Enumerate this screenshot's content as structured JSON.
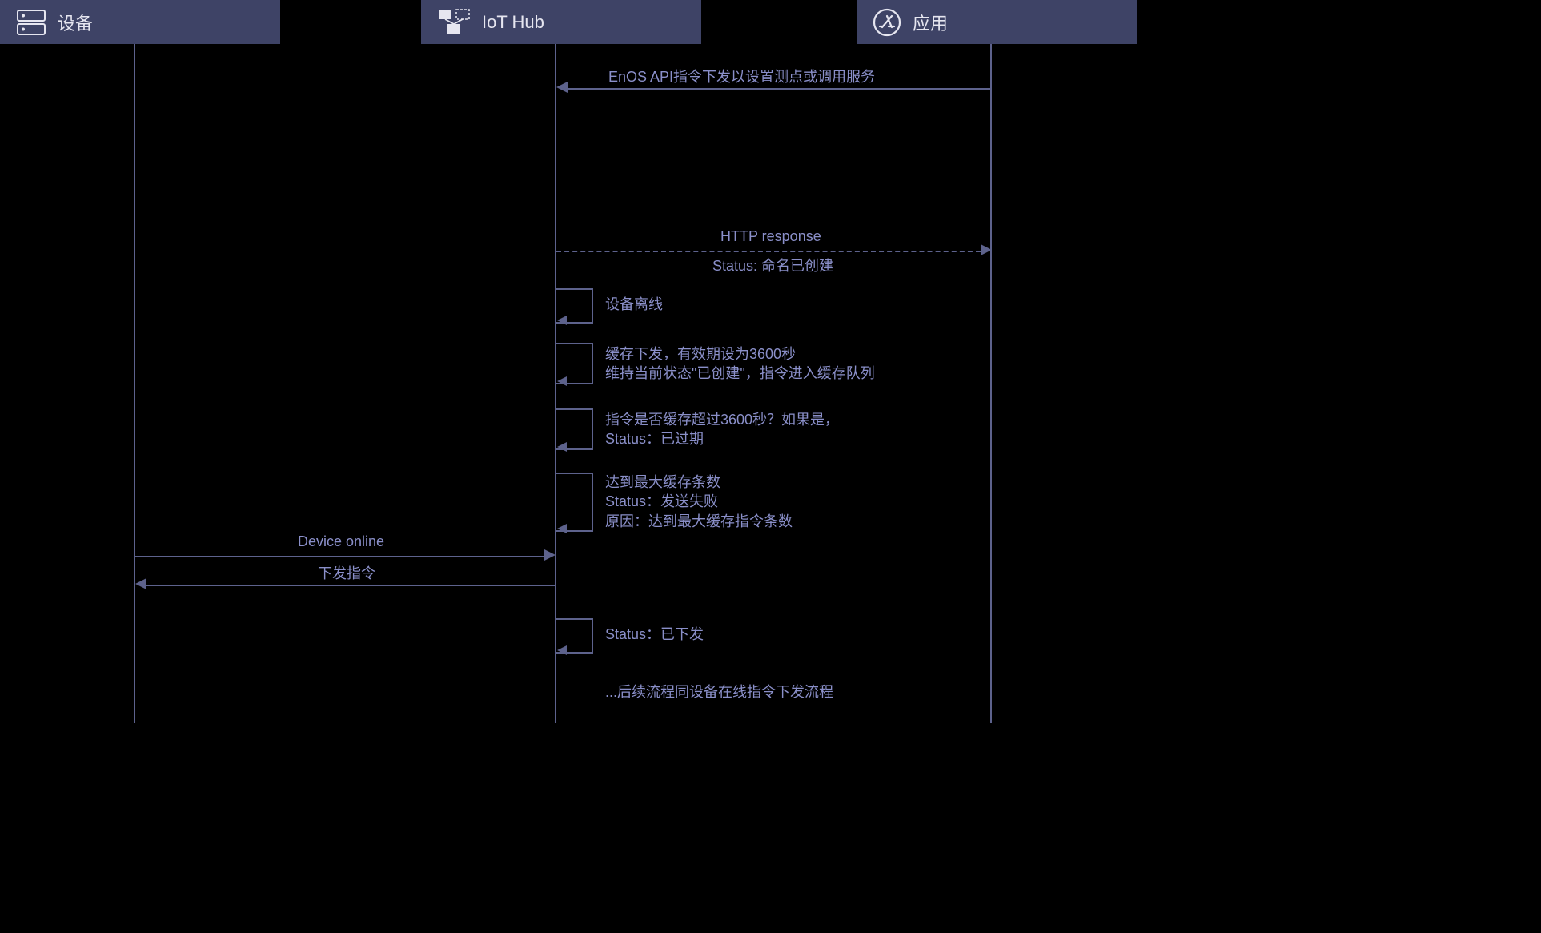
{
  "participants": {
    "device": "设备",
    "iothub": "IoT Hub",
    "app": "应用"
  },
  "messages": {
    "api_call": "EnOS API指令下发以设置测点或调用服务",
    "http_response": "HTTP response",
    "http_status": "Status: 命名已创建",
    "self1": "设备离线",
    "self2_line1": "缓存下发，有效期设为3600秒",
    "self2_line2": "维持当前状态\"已创建\"，指令进入缓存队列",
    "self3_line1": "指令是否缓存超过3600秒？如果是，",
    "self3_line2": "Status：已过期",
    "self4_line1": "达到最大缓存条数",
    "self4_line2": "Status：发送失败",
    "self4_line3": "原因：达到最大缓存指令条数",
    "device_online": "Device online",
    "issue_cmd": "下发指令",
    "self5": "Status：已下发",
    "footer": "...后续流程同设备在线指令下发流程"
  }
}
